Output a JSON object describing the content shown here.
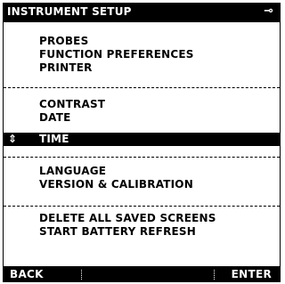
{
  "header": {
    "title": "INSTRUMENT SETUP",
    "icon": "power-plug-icon"
  },
  "menu": {
    "groups": [
      [
        "PROBES",
        "FUNCTION PREFERENCES",
        "PRINTER"
      ],
      [
        "CONTRAST",
        "DATE",
        "TIME"
      ],
      [
        "LANGUAGE",
        "VERSION & CALIBRATION"
      ],
      [
        "DELETE ALL SAVED SCREENS",
        "START BATTERY REFRESH"
      ]
    ],
    "selected": "TIME",
    "selected_marker": "⇕"
  },
  "softkeys": {
    "left": "BACK",
    "right": "ENTER"
  }
}
